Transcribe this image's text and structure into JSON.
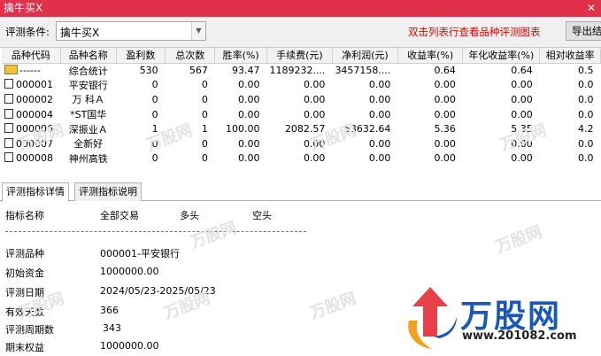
{
  "window": {
    "title": "擒牛买X",
    "close_glyph": "✕"
  },
  "toolbar": {
    "condition_label": "评测条件:",
    "condition_value": "擒牛买X",
    "hint": "双击列表行查看品种评测图表",
    "export_label": "导出结"
  },
  "table": {
    "headers": [
      "品种代码",
      "品种名称",
      "盈利数",
      "总次数",
      "胜率(%)",
      "手续费(元)",
      "净利润(元)",
      "收益率(%)",
      "年化收益率(%)",
      "相对收益率"
    ],
    "rows": [
      {
        "code": "------",
        "name": "综合统计",
        "wins": "530",
        "total": "567",
        "winrate": "93.47",
        "fee": "1189232....",
        "profit": "3457158....",
        "ret": "0.64",
        "annual": "0.64",
        "rel": "0.5"
      },
      {
        "code": "000001",
        "name": "平安银行",
        "wins": "0",
        "total": "0",
        "winrate": "0.00",
        "fee": "0.00",
        "profit": "0.00",
        "ret": "0.00",
        "annual": "0.00",
        "rel": "0.0"
      },
      {
        "code": "000002",
        "name": "万 科Ａ",
        "wins": "0",
        "total": "0",
        "winrate": "0.00",
        "fee": "0.00",
        "profit": "0.00",
        "ret": "0.00",
        "annual": "0.00",
        "rel": "0.0"
      },
      {
        "code": "000004",
        "name": "*ST国华",
        "wins": "0",
        "total": "0",
        "winrate": "0.00",
        "fee": "0.00",
        "profit": "0.00",
        "ret": "0.00",
        "annual": "0.00",
        "rel": "0.0"
      },
      {
        "code": "000006",
        "name": "深振业Ａ",
        "wins": "1",
        "total": "1",
        "winrate": "100.00",
        "fee": "2082.57",
        "profit": "53632.64",
        "ret": "5.36",
        "annual": "5.35",
        "rel": "4.2"
      },
      {
        "code": "000007",
        "name": "全新好",
        "wins": "0",
        "total": "0",
        "winrate": "0.00",
        "fee": "0.00",
        "profit": "0.00",
        "ret": "0.00",
        "annual": "0.00",
        "rel": "0.0"
      },
      {
        "code": "000008",
        "name": "神州高铁",
        "wins": "0",
        "total": "0",
        "winrate": "0.00",
        "fee": "0.00",
        "profit": "0.00",
        "ret": "0.00",
        "annual": "0.00",
        "rel": "0.0"
      }
    ]
  },
  "tabs": [
    "评测指标详情",
    "评测指标说明"
  ],
  "detail": {
    "col_headers": [
      "指标名称",
      "全部交易",
      "多头",
      "空头"
    ],
    "items": [
      {
        "label": "评测品种",
        "value": "000001-平安银行"
      },
      {
        "label": "初始资金",
        "value": "1000000.00"
      },
      {
        "label": "评测日期",
        "value": "2024/05/23-2025/05/23"
      },
      {
        "label": "有效天数",
        "value": "366"
      },
      {
        "label": "评测周期数",
        "value": "343"
      },
      {
        "label": "期末权益",
        "value": "1000000.00"
      }
    ]
  },
  "watermark": {
    "text": "万股网",
    "brand": "万股网",
    "url": "www.201082.com"
  }
}
